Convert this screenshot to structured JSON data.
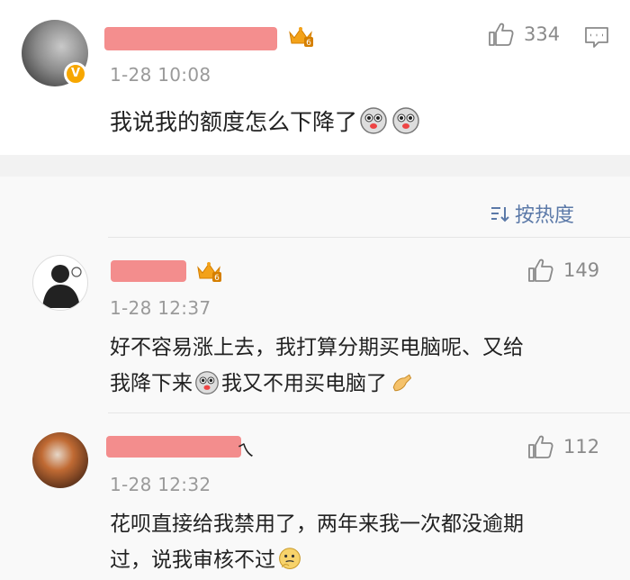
{
  "main_post": {
    "time": "1-28 10:08",
    "text": "我说我的额度怎么下降了",
    "likes": "334",
    "crown_level": "6",
    "verified_badge": "V"
  },
  "sort": {
    "label": "按热度"
  },
  "comments": [
    {
      "time": "1-28 12:37",
      "likes": "149",
      "text_line1": "好不容易涨上去，我打算分期买电脑呢、又给",
      "text_line2a": "我降下来",
      "text_line2b": "我又不用买电脑了",
      "crown_level": "6"
    },
    {
      "time": "1-28 12:32",
      "likes": "112",
      "name_visible_tail": "ㄟ",
      "text_line1": "花呗直接给我禁用了，两年来我一次都没逾期",
      "text_line2": "过，说我审核不过"
    }
  ],
  "icons": {
    "like": "thumbs-up-icon",
    "comment": "comment-icon",
    "crown": "crown-badge-icon",
    "dog_emoji": "doge-emoji",
    "ok_hand": "ok-hand-emoji",
    "thinking": "thinking-emoji"
  },
  "colors": {
    "redaction": "#f27a7a",
    "link_blue": "#5b79a8",
    "crown_gold": "#f3a21a"
  }
}
